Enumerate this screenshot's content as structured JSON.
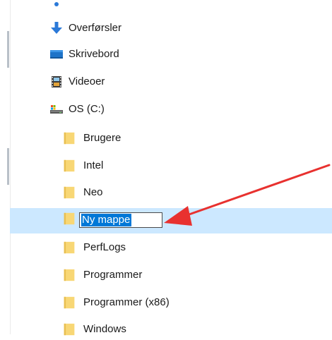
{
  "tree": {
    "items": [
      {
        "label": "Overførsler",
        "icon": "download-arrow-icon"
      },
      {
        "label": "Skrivebord",
        "icon": "desktop-icon"
      },
      {
        "label": "Videoer",
        "icon": "film-icon"
      },
      {
        "label": "OS (C:)",
        "icon": "drive-icon"
      },
      {
        "label": "Brugere",
        "icon": "folder-icon"
      },
      {
        "label": "Intel",
        "icon": "folder-icon"
      },
      {
        "label": "Neo",
        "icon": "folder-icon"
      },
      {
        "label": "Ny mappe",
        "icon": "folder-icon",
        "editing": true
      },
      {
        "label": "PerfLogs",
        "icon": "folder-icon"
      },
      {
        "label": "Programmer",
        "icon": "folder-icon"
      },
      {
        "label": "Programmer (x86)",
        "icon": "folder-icon"
      },
      {
        "label": "Windows",
        "icon": "folder-icon"
      }
    ]
  },
  "rename": {
    "value": "Ny mappe"
  },
  "colors": {
    "selection_row": "#cce8ff",
    "text_selection": "#0078d7",
    "folder": "#f8d775",
    "annotation_arrow": "#e8312f",
    "download_blue": "#2b79d8"
  }
}
